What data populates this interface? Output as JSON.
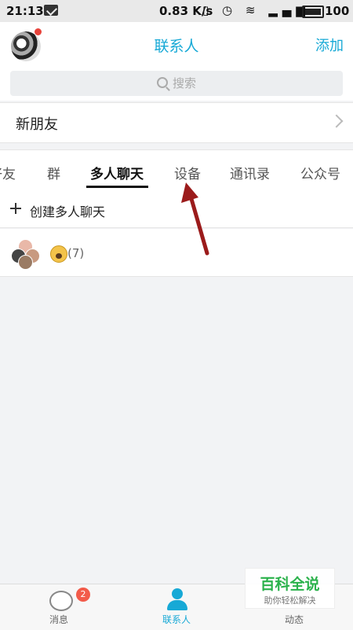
{
  "status_bar": {
    "time": "21:13",
    "speed": "0.83 K/s",
    "battery": "100"
  },
  "header": {
    "title": "联系人",
    "add_label": "添加"
  },
  "search": {
    "placeholder": "搜索"
  },
  "new_friends": {
    "label": "新朋友"
  },
  "tabs": [
    {
      "label": "好友",
      "active": false
    },
    {
      "label": "群",
      "active": false
    },
    {
      "label": "多人聊天",
      "active": true
    },
    {
      "label": "设备",
      "active": false
    },
    {
      "label": "通讯录",
      "active": false
    },
    {
      "label": "公众号",
      "active": false
    }
  ],
  "group_chat": {
    "create_label": "创建多人聊天",
    "rows": [
      {
        "member_count": "(7)"
      }
    ]
  },
  "bottom_nav": {
    "items": [
      {
        "label": "消息",
        "badge": "2",
        "active": false
      },
      {
        "label": "联系人",
        "active": true
      },
      {
        "label": "动态",
        "active": false
      }
    ]
  },
  "watermark": {
    "title": "百科全说",
    "subtitle": "助你轻松解决"
  },
  "colors": {
    "accent": "#17a9d6",
    "annotation_arrow": "#9b1b1b",
    "badge": "#f25b4a"
  }
}
